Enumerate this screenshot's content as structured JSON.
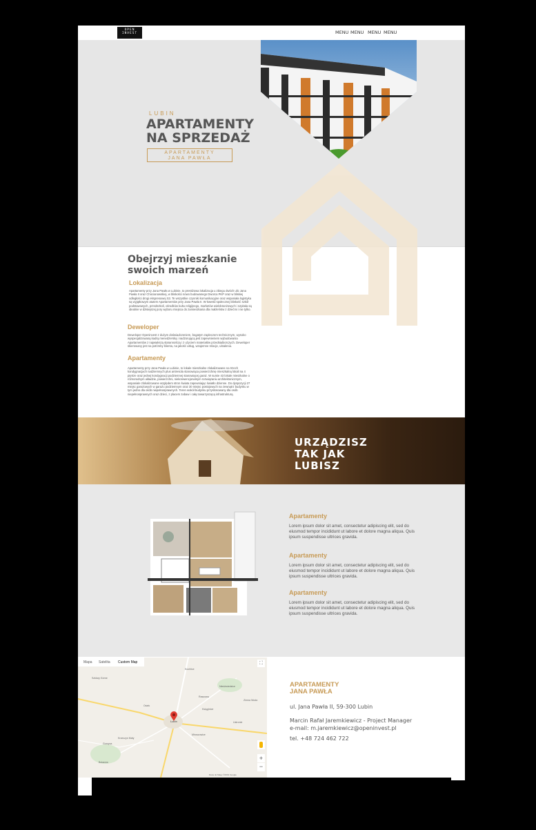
{
  "nav": {
    "logo_lines": [
      "OPEN",
      "INVEST"
    ],
    "menu": [
      "MENU",
      "MENU",
      "MENU",
      "MENU"
    ]
  },
  "hero": {
    "city": "LUBIN",
    "title_line1": "APARTAMENTY",
    "title_line2": "NA SPRZEDAŻ",
    "button_line1": "APARTAMENTY",
    "button_line2": "JANA PAWŁA"
  },
  "about": {
    "title_line1": "Obejrzyj mieszkanie",
    "title_line2": "swoich marzeń",
    "sections": [
      {
        "heading": "Lokalizacja",
        "text": "Apartamenty przy Jana Pawła w Lubinie, to prestiżowa lokalizacja u zbiegu dwóch ulic Jana Pawła II oraz Chocianowskiej, w bliskości nowo budowanego Dworca PKP oraz w bliskiej odległości drogi ekspresowej S3. Te wszystkie czynniki komunikacyjne oraz wspaniała logistyka są wyjątkowym atutem Apartamentów przy Jana Pawła II. W kwestii społecznej bliskość szkół podstawowych, przedszkoli, ośrodków kultu religijnego, marketów wielobranżowych i szpitala są idealnie w dzisiejszej pory wyboru miejsca do zamieszkania dla małżeństw z dziećmi i nie tylko."
      },
      {
        "heading": "Deweloper",
        "text": "Deweloper Openinvest z dużym doświadczeniem, bogatym zapleczem technicznym, wysoko wyspecjalizowaną kadrą menedżerską i nadzorującą jest zapewnieniem wybudowania Apartamentów z największą starannością i z użyciem materiałów przedsiębiorczych. Deweloper skierowany jest na potrzeby klienta, na jakość usług, wzajemne relacje, ustalenia."
      },
      {
        "heading": "Apartamenty",
        "text": "Apartamenty przy Jana Pawła w Lubinie, to lokale mieszkalne zlokalizowane na trzech kondygnacjach nadziemnych plus antresola stanowiąca powierzchnię mieszkalną lokali na 4 piętrze oraz jednej kondygnacji podziemnej stanowiącej garaż. W sumie 43 lokale mieszkalne o różnorodnym układzie, powierzchni, niekonwencjonalnym rozwiązaniu architektonicznym, wspaniale zlokalizowane względem stron świata zapewniając światło dzienne. Do dyspozycji 27 miejsc garażowych w garażu podziemnym oraz 30 miejsc postojowych na zewnątrz budynku w tym jedno dla osób niepełnosprawnych. Teren wokół budynku przystosowany dla osób niepełnosprawnych oraz dzieci, z placem zabaw i całą towarzyszącą infrastrukturą."
      }
    ]
  },
  "banner": {
    "lines": [
      "URZĄDZISZ",
      "TAK JAK",
      "LUBISZ"
    ]
  },
  "plans": [
    {
      "heading": "Apartamenty",
      "text": "Lorem ipsum dolor sit amet, consectetur adipiscing elit, sed do eiusmod tempor incididunt ut labore et dolore magna aliqua. Quis ipsum suspendisse ultrices gravida."
    },
    {
      "heading": "Apartamenty",
      "text": "Lorem ipsum dolor sit amet, consectetur adipiscing elit, sed do eiusmod tempor incididunt ut labore et dolore magna aliqua. Quis ipsum suspendisse ultrices gravida."
    },
    {
      "heading": "Apartamenty",
      "text": "Lorem ipsum dolor sit amet, consectetur adipiscing elit, sed do eiusmod tempor incididunt ut labore et dolore magna aliqua. Quis ipsum suspendisse ultrices gravida."
    }
  ],
  "map": {
    "tabs": [
      "Mapa",
      "Satelita",
      "Custom Map"
    ],
    "towns": [
      "Lubin",
      "Kochlice",
      "Szklary Górne",
      "Niedźwiedzice",
      "Osiek",
      "Krzeczyn Mały",
      "Gorzyca",
      "Bolanów",
      "Raszowa",
      "Księginice",
      "Miroszowice",
      "Ustronie",
      "Zimna Woda"
    ],
    "attribution": "Dane do Mapy ©2019 Google"
  },
  "contact": {
    "title_line1": "APARTAMENTY",
    "title_line2": "JANA PAWŁA",
    "address": "ul. Jana Pawła II, 59-300 Lubin",
    "manager": "Marcin Rafał Jaremkiewicz - Project Manager",
    "email": "e-mail: m.jaremkiewicz@openinvest.pl",
    "phone": "tel. +48 724 462 722"
  },
  "colors": {
    "accent": "#c79a55",
    "hero_bg": "#e6e6e6",
    "text": "#555555"
  }
}
